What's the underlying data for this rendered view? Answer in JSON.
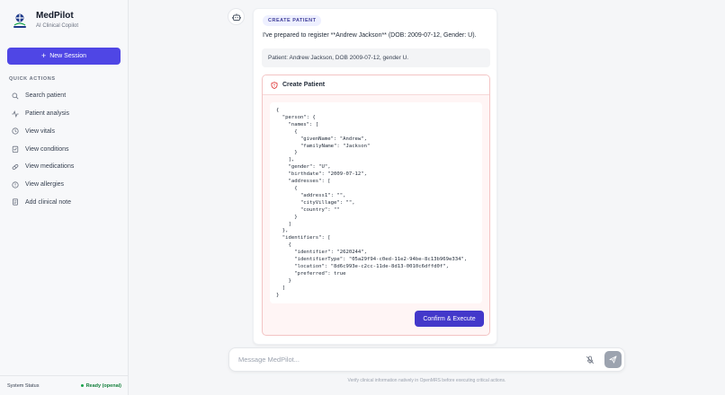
{
  "brand": {
    "title": "MedPilot",
    "subtitle": "AI Clinical Copilot"
  },
  "sidebar": {
    "new_session_label": "New Session",
    "quick_actions_heading": "QUICK ACTIONS",
    "items": [
      {
        "label": "Search patient",
        "icon": "search-icon"
      },
      {
        "label": "Patient analysis",
        "icon": "activity-icon"
      },
      {
        "label": "View vitals",
        "icon": "clock-icon"
      },
      {
        "label": "View conditions",
        "icon": "clipboard-icon"
      },
      {
        "label": "View medications",
        "icon": "pill-icon"
      },
      {
        "label": "View allergies",
        "icon": "alert-icon"
      },
      {
        "label": "Add clinical note",
        "icon": "note-icon"
      }
    ],
    "status_label": "System Status",
    "status_value": "Ready (openai)"
  },
  "message": {
    "tool_chip": "CREATE PATIENT",
    "text": "I've prepared to register **Andrew Jackson** (DOB: 2009-07-12, Gender: U).",
    "summary": "Patient: Andrew Jackson, DOB 2009-07-12, gender U.",
    "action_title": "Create Patient",
    "payload": "{\n  \"person\": {\n    \"names\": [\n      {\n        \"givenName\": \"Andrew\",\n        \"familyName\": \"Jackson\"\n      }\n    ],\n    \"gender\": \"U\",\n    \"birthdate\": \"2009-07-12\",\n    \"addresses\": [\n      {\n        \"address1\": \"\",\n        \"cityVillage\": \"\",\n        \"country\": \"\"\n      }\n    ]\n  },\n  \"identifiers\": [\n    {\n      \"identifier\": \"2620244\",\n      \"identifierType\": \"05a29f94-c0ed-11e2-94be-8c13b969e334\",\n      \"location\": \"8d6c993e-c2cc-11de-8d13-0010c6dffd0f\",\n      \"preferred\": true\n    }\n  ]\n}",
    "confirm_label": "Confirm & Execute"
  },
  "composer": {
    "placeholder": "Message MedPilot...",
    "disclaimer": "Verify clinical information natively in OpenMRS before executing critical actions."
  },
  "colors": {
    "accent": "#4f46e5",
    "confirm": "#4338ca",
    "danger_border": "#f3c4c4",
    "status_ok": "#16a34a"
  }
}
